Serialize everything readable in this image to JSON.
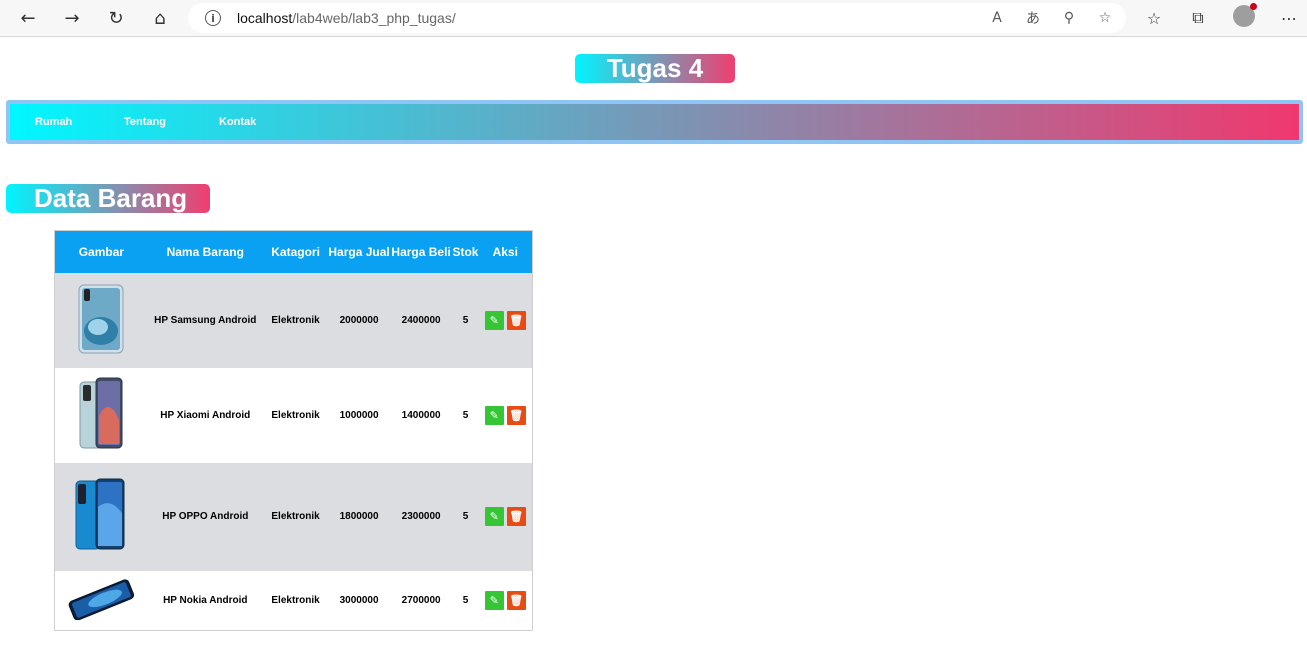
{
  "browser": {
    "url_host": "localhost",
    "url_path": "/lab4web/lab3_php_tugas/"
  },
  "page": {
    "title": "Tugas 4",
    "nav": [
      "Rumah",
      "Tentang",
      "Kontak"
    ],
    "section_title": "Data Barang"
  },
  "table": {
    "headers": [
      "Gambar",
      "Nama Barang",
      "Katagori",
      "Harga Jual",
      "Harga Beli",
      "Stok",
      "Aksi"
    ],
    "rows": [
      {
        "nama": "HP Samsung Android",
        "kategori": "Elektronik",
        "harga_jual": "2000000",
        "harga_beli": "2400000",
        "stok": "5"
      },
      {
        "nama": "HP Xiaomi Android",
        "kategori": "Elektronik",
        "harga_jual": "1000000",
        "harga_beli": "1400000",
        "stok": "5"
      },
      {
        "nama": "HP OPPO Android",
        "kategori": "Elektronik",
        "harga_jual": "1800000",
        "harga_beli": "2300000",
        "stok": "5"
      },
      {
        "nama": "HP Nokia Android",
        "kategori": "Elektronik",
        "harga_jual": "3000000",
        "harga_beli": "2700000",
        "stok": "5"
      }
    ]
  },
  "colors": {
    "gradient_start": "#00f5ff",
    "gradient_end": "#f03e6f",
    "table_header": "#0aa1f2",
    "edit_button": "#35c535",
    "delete_button": "#e74c14"
  }
}
